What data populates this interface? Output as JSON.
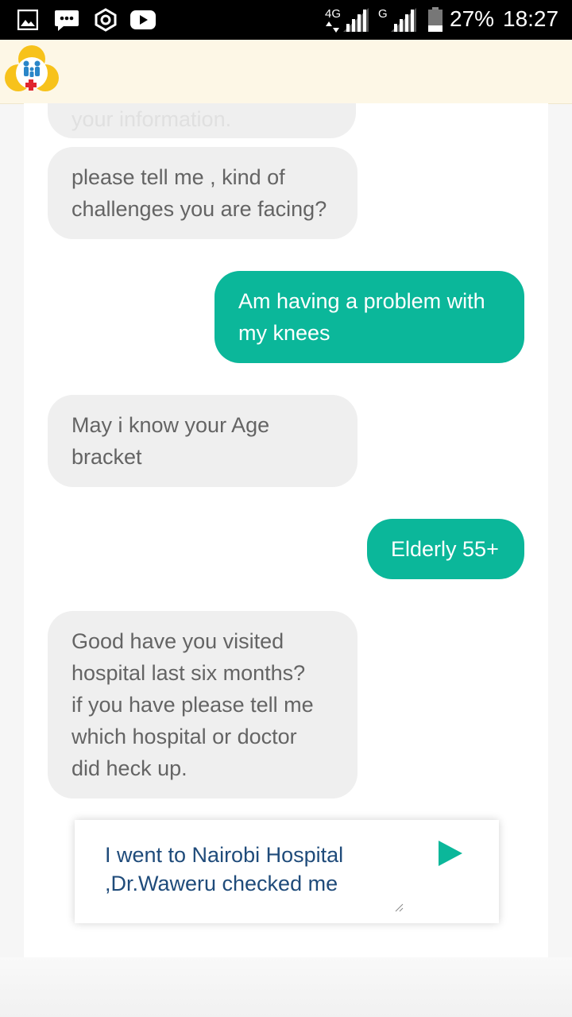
{
  "status_bar": {
    "network_4g": "4G",
    "network_g": "G",
    "battery": "27%",
    "time": "18:27",
    "icons": [
      "gallery-icon",
      "message-icon",
      "settings-icon",
      "youtube-icon"
    ]
  },
  "app": {
    "logo": "family-health-logo",
    "accent_color": "#0bb79a",
    "header_color": "#fdf7e6"
  },
  "chat": {
    "messages": [
      {
        "sender": "bot",
        "text": "your information."
      },
      {
        "sender": "bot",
        "text": "please tell me , kind of\nchallenges you are facing?"
      },
      {
        "sender": "user",
        "text": "Am having a problem with\nmy knees"
      },
      {
        "sender": "bot",
        "text": "May i know your Age\nbracket"
      },
      {
        "sender": "user",
        "text": "Elderly 55+"
      },
      {
        "sender": "bot",
        "text": "Good have you visited\nhospital last six months?\nif you have please tell me\nwhich hospital or doctor\ndid heck up."
      }
    ]
  },
  "composer": {
    "value": "I went to Nairobi Hospital\n,Dr.Waweru checked me",
    "send_icon": "send-icon"
  }
}
